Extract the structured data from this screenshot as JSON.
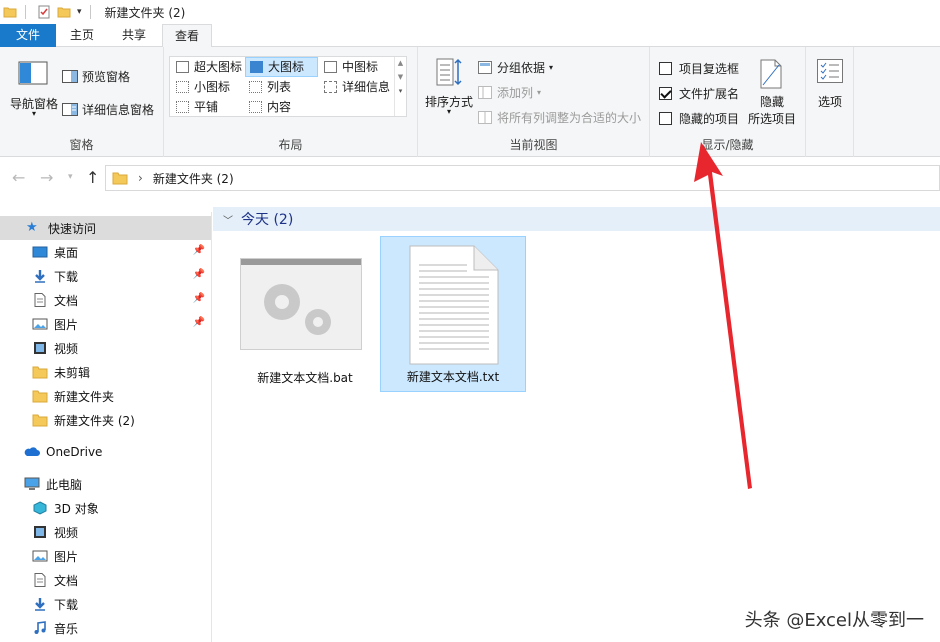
{
  "window": {
    "title": "新建文件夹 (2)"
  },
  "tabs": {
    "file": "文件",
    "home": "主页",
    "share": "共享",
    "view": "查看"
  },
  "ribbon": {
    "panes": {
      "nav_pane": "导航窗格",
      "preview_pane": "预览窗格",
      "details_pane": "详细信息窗格",
      "label": "窗格"
    },
    "layout": {
      "extra_large": "超大图标",
      "large": "大图标",
      "medium": "中图标",
      "small": "小图标",
      "list": "列表",
      "details": "详细信息",
      "tiles": "平铺",
      "content": "内容",
      "label": "布局"
    },
    "current_view": {
      "sort_by": "排序方式",
      "group_by": "分组依据",
      "add_columns": "添加列",
      "size_all": "将所有列调整为合适的大小",
      "label": "当前视图"
    },
    "show_hide": {
      "item_checkboxes": "项目复选框",
      "file_extensions": "文件扩展名",
      "hidden_items": "隐藏的项目",
      "hide_selected_1": "隐藏",
      "hide_selected_2": "所选项目",
      "label": "显示/隐藏"
    },
    "options": "选项",
    "state": {
      "item_checkboxes": false,
      "file_extensions": true,
      "hidden_items": false
    }
  },
  "address": {
    "path": "新建文件夹 (2)"
  },
  "sidebar": {
    "quick_access": "快速访问",
    "qa_items": [
      "桌面",
      "下载",
      "文档",
      "图片",
      "视频",
      "未剪辑",
      "新建文件夹",
      "新建文件夹 (2)"
    ],
    "onedrive": "OneDrive",
    "this_pc": "此电脑",
    "pc_items": [
      "3D 对象",
      "视频",
      "图片",
      "文档",
      "下载",
      "音乐"
    ]
  },
  "content": {
    "group_header": "今天 (2)",
    "files": [
      {
        "name": "新建文本文档.bat"
      },
      {
        "name": "新建文本文档.txt"
      }
    ]
  },
  "watermark": "头条 @Excel从零到一",
  "colors": {
    "accent": "#1979ca",
    "selection": "#cce8ff",
    "arrow": "#e8262d"
  }
}
